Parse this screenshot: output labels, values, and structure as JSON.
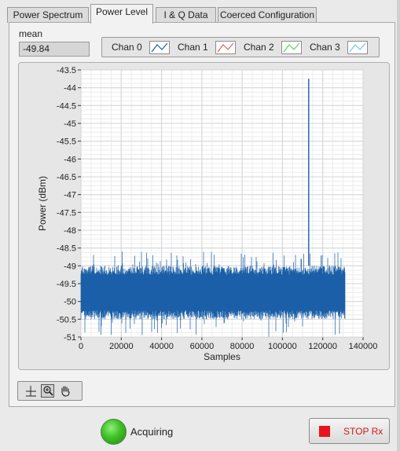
{
  "tabs": [
    {
      "label": "Power Spectrum",
      "active": false
    },
    {
      "label": "Power Level",
      "active": true
    },
    {
      "label": "I & Q Data",
      "active": false
    },
    {
      "label": "Coerced Configuration",
      "active": false
    }
  ],
  "mean": {
    "label": "mean",
    "value": "-49.84"
  },
  "legend": [
    {
      "name": "Chan 0",
      "color": "#1a5fa8"
    },
    {
      "name": "Chan 1",
      "color": "#e86060"
    },
    {
      "name": "Chan 2",
      "color": "#5ad25a"
    },
    {
      "name": "Chan 3",
      "color": "#6ec8e8"
    }
  ],
  "chart_data": {
    "type": "line",
    "title": "",
    "xlabel": "Samples",
    "ylabel": "Power (dBm)",
    "xlim": [
      0,
      140000
    ],
    "ylim": [
      -51,
      -43.5
    ],
    "x_ticks": [
      "0",
      "20000",
      "40000",
      "60000",
      "80000",
      "100000",
      "120000",
      "140000"
    ],
    "y_ticks": [
      "-43.5",
      "-44",
      "-44.5",
      "-45",
      "-45.5",
      "-46",
      "-46.5",
      "-47",
      "-47.5",
      "-48",
      "-48.5",
      "-49",
      "-49.5",
      "-50",
      "-50.5",
      "-51"
    ],
    "grid": true,
    "legend_position": "top",
    "series": [
      {
        "name": "Chan 0",
        "color": "#1a5fa8",
        "x_range": [
          0,
          131072
        ],
        "noise_band_typical": [
          -50.5,
          -49.0
        ],
        "noise_extremes": [
          -51.0,
          -48.6
        ],
        "spike": {
          "x": 113000,
          "y": -43.75
        }
      }
    ]
  },
  "palette": {
    "icons": [
      "cursor-move-icon",
      "zoom-icon",
      "pan-hand-icon"
    ]
  },
  "status": {
    "label": "Acquiring",
    "led_color": "#3cc223"
  },
  "stop_button": {
    "label": "STOP Rx"
  }
}
